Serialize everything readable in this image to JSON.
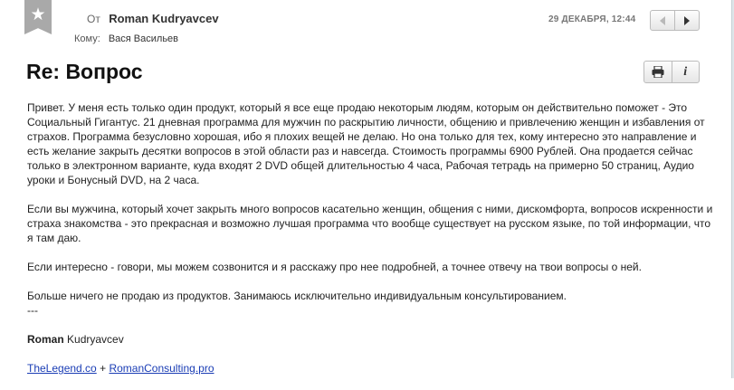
{
  "header": {
    "bookmark_icon": "star-icon",
    "from_label": "От",
    "from_name": "Roman Kudryavcev",
    "to_label": "Кому:",
    "to_name": "Вася Васильев",
    "date": "29 ДЕКАБРЯ, 12:44",
    "nav": {
      "prev_icon": "chevron-left-icon",
      "next_icon": "chevron-right-icon"
    }
  },
  "subject": "Re: Вопрос",
  "tools": {
    "print_icon": "printer-icon",
    "info_label": "i"
  },
  "body": {
    "paragraphs": [
      "Привет. У меня есть только один продукт, который я все еще продаю некоторым людям, которым он действительно поможет - Это Социальный Гигантус. 21 дневная программа для мужчин по раскрытию личности, общению и привлечению женщин и избавления от страхов. Программа безусловно хорошая, ибо я плохих вещей не делаю. Но она только для тех, кому интересно это направление и есть желание закрыть десятки вопросов в этой области раз и навсегда. Стоимость программы 6900 Рублей. Она продается сейчас только в электронном варианте, куда входят 2 DVD общей длительностью 4 часа, Рабочая тетрадь на примерно 50 страниц, Аудио уроки и Бонусный DVD, на 2 часа.",
      "Если вы мужчина, который хочет закрыть много вопросов касательно женщин, общения с ними, дискомфорта, вопросов искренности и страха знакомства - это прекрасная и возможно лучшая программа что вообще существует на русском языке, по той информации, что я там даю.",
      "Если интересно - говори, мы можем созвонится и я расскажу про нее подробней, а точнее отвечу на твои вопросы о ней.",
      "Больше ничего не продаю из продуктов. Занимаюсь исключительно индивидуальным консультированием."
    ],
    "signature_separator": "---",
    "signature_first": "Roman",
    "signature_last": "Kudryavcev",
    "link1": "TheLegend.co",
    "link_joiner": "+",
    "link2": "RomanConsulting.pro"
  }
}
